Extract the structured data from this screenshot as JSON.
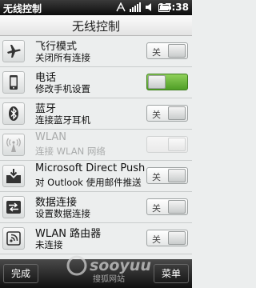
{
  "status_bar": {
    "title": "无线控制",
    "time": "17:38"
  },
  "header": {
    "title": "无线控制"
  },
  "toggle_labels": {
    "off": "关",
    "on": "开"
  },
  "items": [
    {
      "title": "飞行模式",
      "subtitle": "关闭所有连接",
      "icon": "airplane-icon",
      "state": "off",
      "enabled": true
    },
    {
      "title": "电话",
      "subtitle": "修改手机设置",
      "icon": "phone-icon",
      "state": "on",
      "enabled": true
    },
    {
      "title": "蓝牙",
      "subtitle": "连接蓝牙耳机",
      "icon": "bluetooth-icon",
      "state": "off",
      "enabled": true
    },
    {
      "title": "WLAN",
      "subtitle": "连接 WLAN 网络",
      "icon": "wifi-tower-icon",
      "state": "off",
      "enabled": false
    },
    {
      "title": "Microsoft Direct Push",
      "subtitle": "对 Outlook 使用邮件推送",
      "icon": "push-mail-icon",
      "state": "off",
      "enabled": true
    },
    {
      "title": "数据连接",
      "subtitle": "设置数据连接",
      "icon": "data-connection-icon",
      "state": "off",
      "enabled": true
    },
    {
      "title": "WLAN 路由器",
      "subtitle": "未连接",
      "icon": "wlan-router-icon",
      "state": "off",
      "enabled": true
    }
  ],
  "softkeys": {
    "left": "完成",
    "right": "菜单"
  },
  "watermark": {
    "brand": "sooyuu",
    "tagline": "搜狐网站"
  },
  "colors": {
    "toggle_on": "#5aa82e",
    "status_bar": "#1a1a1a"
  }
}
